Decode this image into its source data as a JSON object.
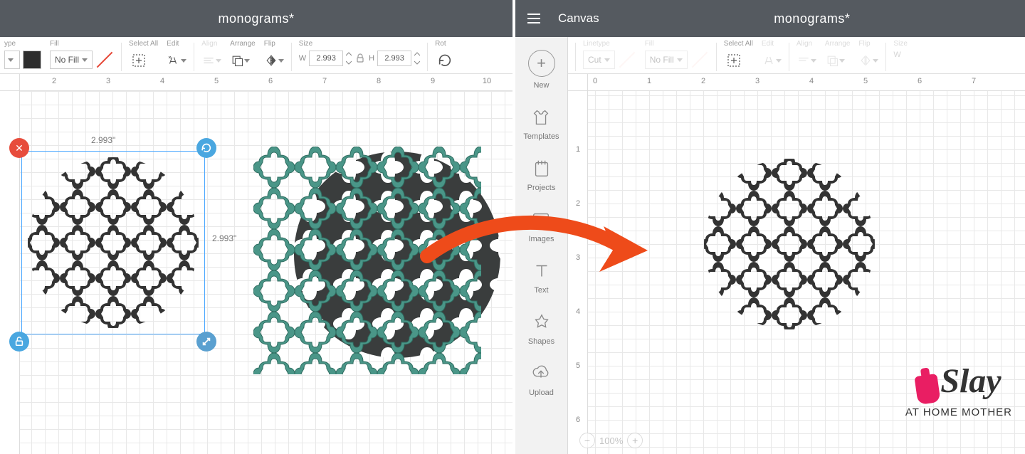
{
  "left": {
    "title": "monograms*",
    "toolbar": {
      "linetype_label": "ype",
      "fill_label": "Fill",
      "fill_value": "No Fill",
      "select_all": "Select All",
      "edit": "Edit",
      "align": "Align",
      "arrange": "Arrange",
      "flip": "Flip",
      "size": "Size",
      "width_label": "W",
      "width_value": "2.993",
      "height_label": "H",
      "height_value": "2.993",
      "rotate": "Rot"
    },
    "ruler_h": [
      "2",
      "3",
      "4",
      "5",
      "6",
      "7",
      "8",
      "9",
      "10"
    ],
    "selection": {
      "width_label": "2.993\"",
      "height_label": "2.993\""
    }
  },
  "right": {
    "canvas_label": "Canvas",
    "title": "monograms*",
    "toolbar": {
      "linetype_label": "Linetype",
      "linetype_value": "Cut",
      "fill_label": "Fill",
      "fill_value": "No Fill",
      "select_all": "Select All",
      "edit": "Edit",
      "align": "Align",
      "arrange": "Arrange",
      "flip": "Flip",
      "size": "Size",
      "width_label": "W"
    },
    "sidepanel": {
      "new": "New",
      "templates": "Templates",
      "projects": "Projects",
      "images": "Images",
      "text": "Text",
      "shapes": "Shapes",
      "upload": "Upload"
    },
    "ruler_h": [
      "0",
      "1",
      "2",
      "3",
      "4",
      "5",
      "6",
      "7"
    ],
    "ruler_v": [
      "1",
      "2",
      "3",
      "4",
      "5",
      "6"
    ],
    "zoom": "100%"
  },
  "watermark": {
    "main": "Slay",
    "sub": "AT HOME MOTHER"
  }
}
